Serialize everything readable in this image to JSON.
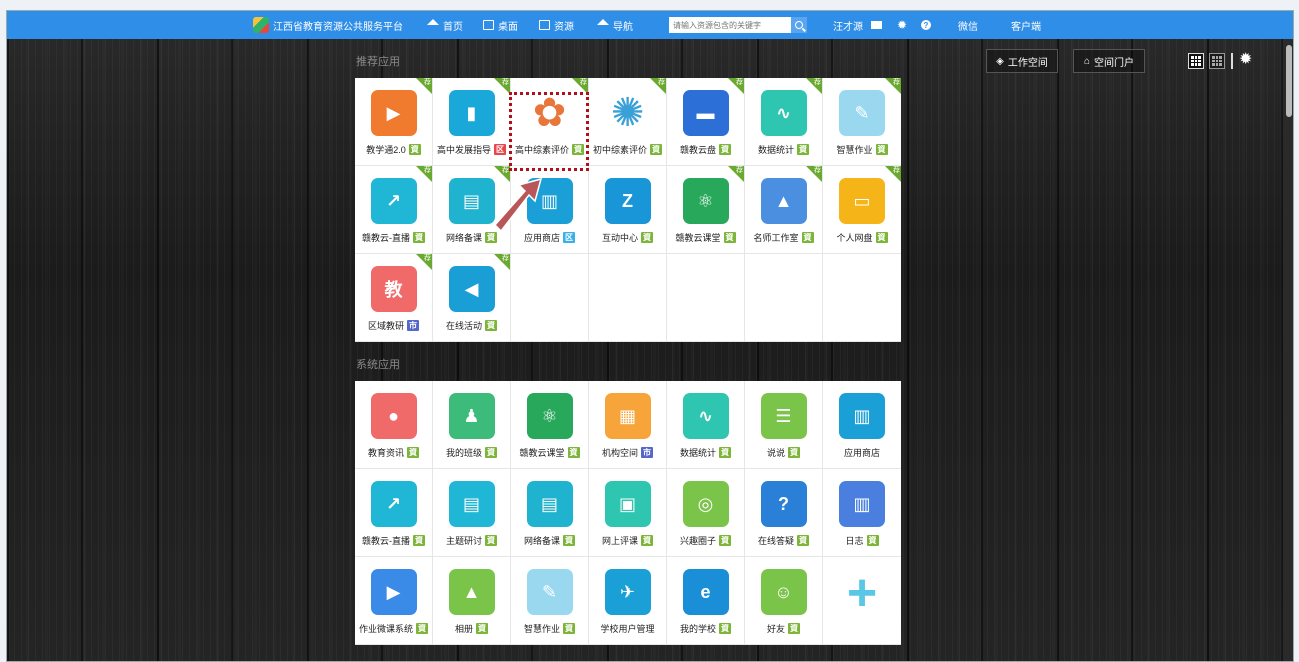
{
  "topbar": {
    "site_title": "江西省教育资源公共服务平台",
    "nav": [
      "首页",
      "桌面",
      "资源",
      "导航"
    ],
    "search_placeholder": "请输入资源包含的关键字",
    "user": "汪才源",
    "wechat": "微信",
    "client": "客户端"
  },
  "header_buttons": {
    "workspace": "工作空间",
    "portal": "空间门户"
  },
  "sections": {
    "recommended": {
      "title": "推荐应用",
      "ribbon": "荐",
      "apps": [
        {
          "label": "教学通2.0",
          "tag": "資",
          "tag_color": "green",
          "color": "#f07b2f",
          "icon": "video-stack-icon",
          "ribbon": true
        },
        {
          "label": "高中发展指导",
          "tag": "区",
          "tag_color": "red",
          "color": "#1aa8d8",
          "icon": "phone-icon",
          "ribbon": true
        },
        {
          "label": "高中综素评价",
          "tag": "資",
          "tag_color": "green",
          "color": "#ffffff",
          "icon": "pinwheel-icon",
          "ribbon": true
        },
        {
          "label": "初中综素评价",
          "tag": "資",
          "tag_color": "green",
          "color": "#ffffff",
          "icon": "swirl-icon",
          "ribbon": true
        },
        {
          "label": "赣教云盘",
          "tag": "資",
          "tag_color": "green",
          "color": "#2c6fd6",
          "icon": "cloud-drive-icon",
          "ribbon": true
        },
        {
          "label": "数据统计",
          "tag": "資",
          "tag_color": "green",
          "color": "#2ec6b0",
          "icon": "stats-icon",
          "ribbon": true
        },
        {
          "label": "智慧作业",
          "tag": "資",
          "tag_color": "green",
          "color": "#9ad8f0",
          "icon": "homework-icon",
          "ribbon": true
        },
        {
          "label": "赣教云-直播",
          "tag": "資",
          "tag_color": "green",
          "color": "#20b7d6",
          "icon": "live-screen-icon",
          "ribbon": true
        },
        {
          "label": "网络备课",
          "tag": "資",
          "tag_color": "green",
          "color": "#1fb3cf",
          "icon": "notebook-icon",
          "ribbon": true
        },
        {
          "label": "应用商店",
          "tag": "区",
          "tag_color": "blue",
          "color": "#1aa0d6",
          "icon": "store-icon",
          "ribbon": false
        },
        {
          "label": "互动中心",
          "tag": "資",
          "tag_color": "green",
          "color": "#1996d8",
          "icon": "star-z-icon",
          "ribbon": false
        },
        {
          "label": "赣教云课堂",
          "tag": "資",
          "tag_color": "green",
          "color": "#27a85a",
          "icon": "atom-screen-icon",
          "ribbon": true
        },
        {
          "label": "名师工作室",
          "tag": "資",
          "tag_color": "green",
          "color": "#4a8fe0",
          "icon": "teacher-icon",
          "ribbon": true
        },
        {
          "label": "个人网盘",
          "tag": "資",
          "tag_color": "green",
          "color": "#f5b418",
          "icon": "disk-icon",
          "ribbon": true
        },
        {
          "label": "区域教研",
          "tag": "市",
          "tag_color": "purple",
          "color": "#f06a6a",
          "icon": "teach-icon",
          "ribbon": true
        },
        {
          "label": "在线活动",
          "tag": "資",
          "tag_color": "green",
          "color": "#1a9ed6",
          "icon": "megaphone-icon",
          "ribbon": true
        }
      ]
    },
    "system": {
      "title": "系统应用",
      "apps": [
        {
          "label": "教育资讯",
          "tag": "資",
          "tag_color": "green",
          "color": "#f06a6a",
          "icon": "news-icon"
        },
        {
          "label": "我的班级",
          "tag": "資",
          "tag_color": "green",
          "color": "#3dbb7a",
          "icon": "class-icon"
        },
        {
          "label": "赣教云课堂",
          "tag": "資",
          "tag_color": "green",
          "color": "#27a85a",
          "icon": "atom-screen-icon"
        },
        {
          "label": "机构空间",
          "tag": "市",
          "tag_color": "purple",
          "color": "#f7a43a",
          "icon": "building-icon"
        },
        {
          "label": "数据统计",
          "tag": "資",
          "tag_color": "green",
          "color": "#2ec6b0",
          "icon": "stats-icon"
        },
        {
          "label": "说说",
          "tag": "資",
          "tag_color": "green",
          "color": "#7bc44a",
          "icon": "chat-icon"
        },
        {
          "label": "应用商店",
          "tag": "",
          "tag_color": "",
          "color": "#1aa0d6",
          "icon": "store-icon"
        },
        {
          "label": "赣教云-直播",
          "tag": "資",
          "tag_color": "green",
          "color": "#20b7d6",
          "icon": "live-screen-icon"
        },
        {
          "label": "主题研讨",
          "tag": "資",
          "tag_color": "green",
          "color": "#20b7d6",
          "icon": "discuss-icon"
        },
        {
          "label": "网络备课",
          "tag": "資",
          "tag_color": "green",
          "color": "#1fb3cf",
          "icon": "notebook-icon"
        },
        {
          "label": "网上评课",
          "tag": "資",
          "tag_color": "green",
          "color": "#2ec6b0",
          "icon": "review-icon"
        },
        {
          "label": "兴趣圈子",
          "tag": "資",
          "tag_color": "green",
          "color": "#7bc44a",
          "icon": "target-icon"
        },
        {
          "label": "在线答疑",
          "tag": "資",
          "tag_color": "green",
          "color": "#2a7fd6",
          "icon": "question-icon"
        },
        {
          "label": "日志",
          "tag": "資",
          "tag_color": "green",
          "color": "#4a7fe0",
          "icon": "journal-icon"
        },
        {
          "label": "作业微课系统",
          "tag": "資",
          "tag_color": "green",
          "color": "#3a8ae8",
          "icon": "tv-icon"
        },
        {
          "label": "相册",
          "tag": "資",
          "tag_color": "green",
          "color": "#7bc44a",
          "icon": "photo-icon"
        },
        {
          "label": "智慧作业",
          "tag": "資",
          "tag_color": "green",
          "color": "#9ad8f0",
          "icon": "homework-icon"
        },
        {
          "label": "学校用户管理",
          "tag": "",
          "tag_color": "",
          "color": "#1aa0d6",
          "icon": "bird-icon"
        },
        {
          "label": "我的学校",
          "tag": "資",
          "tag_color": "green",
          "color": "#1a8ed6",
          "icon": "school-icon"
        },
        {
          "label": "好友",
          "tag": "資",
          "tag_color": "green",
          "color": "#7bc44a",
          "icon": "friends-icon"
        },
        {
          "label": "",
          "tag": "",
          "tag_color": "",
          "color": "",
          "icon": "plus-icon"
        }
      ]
    }
  }
}
